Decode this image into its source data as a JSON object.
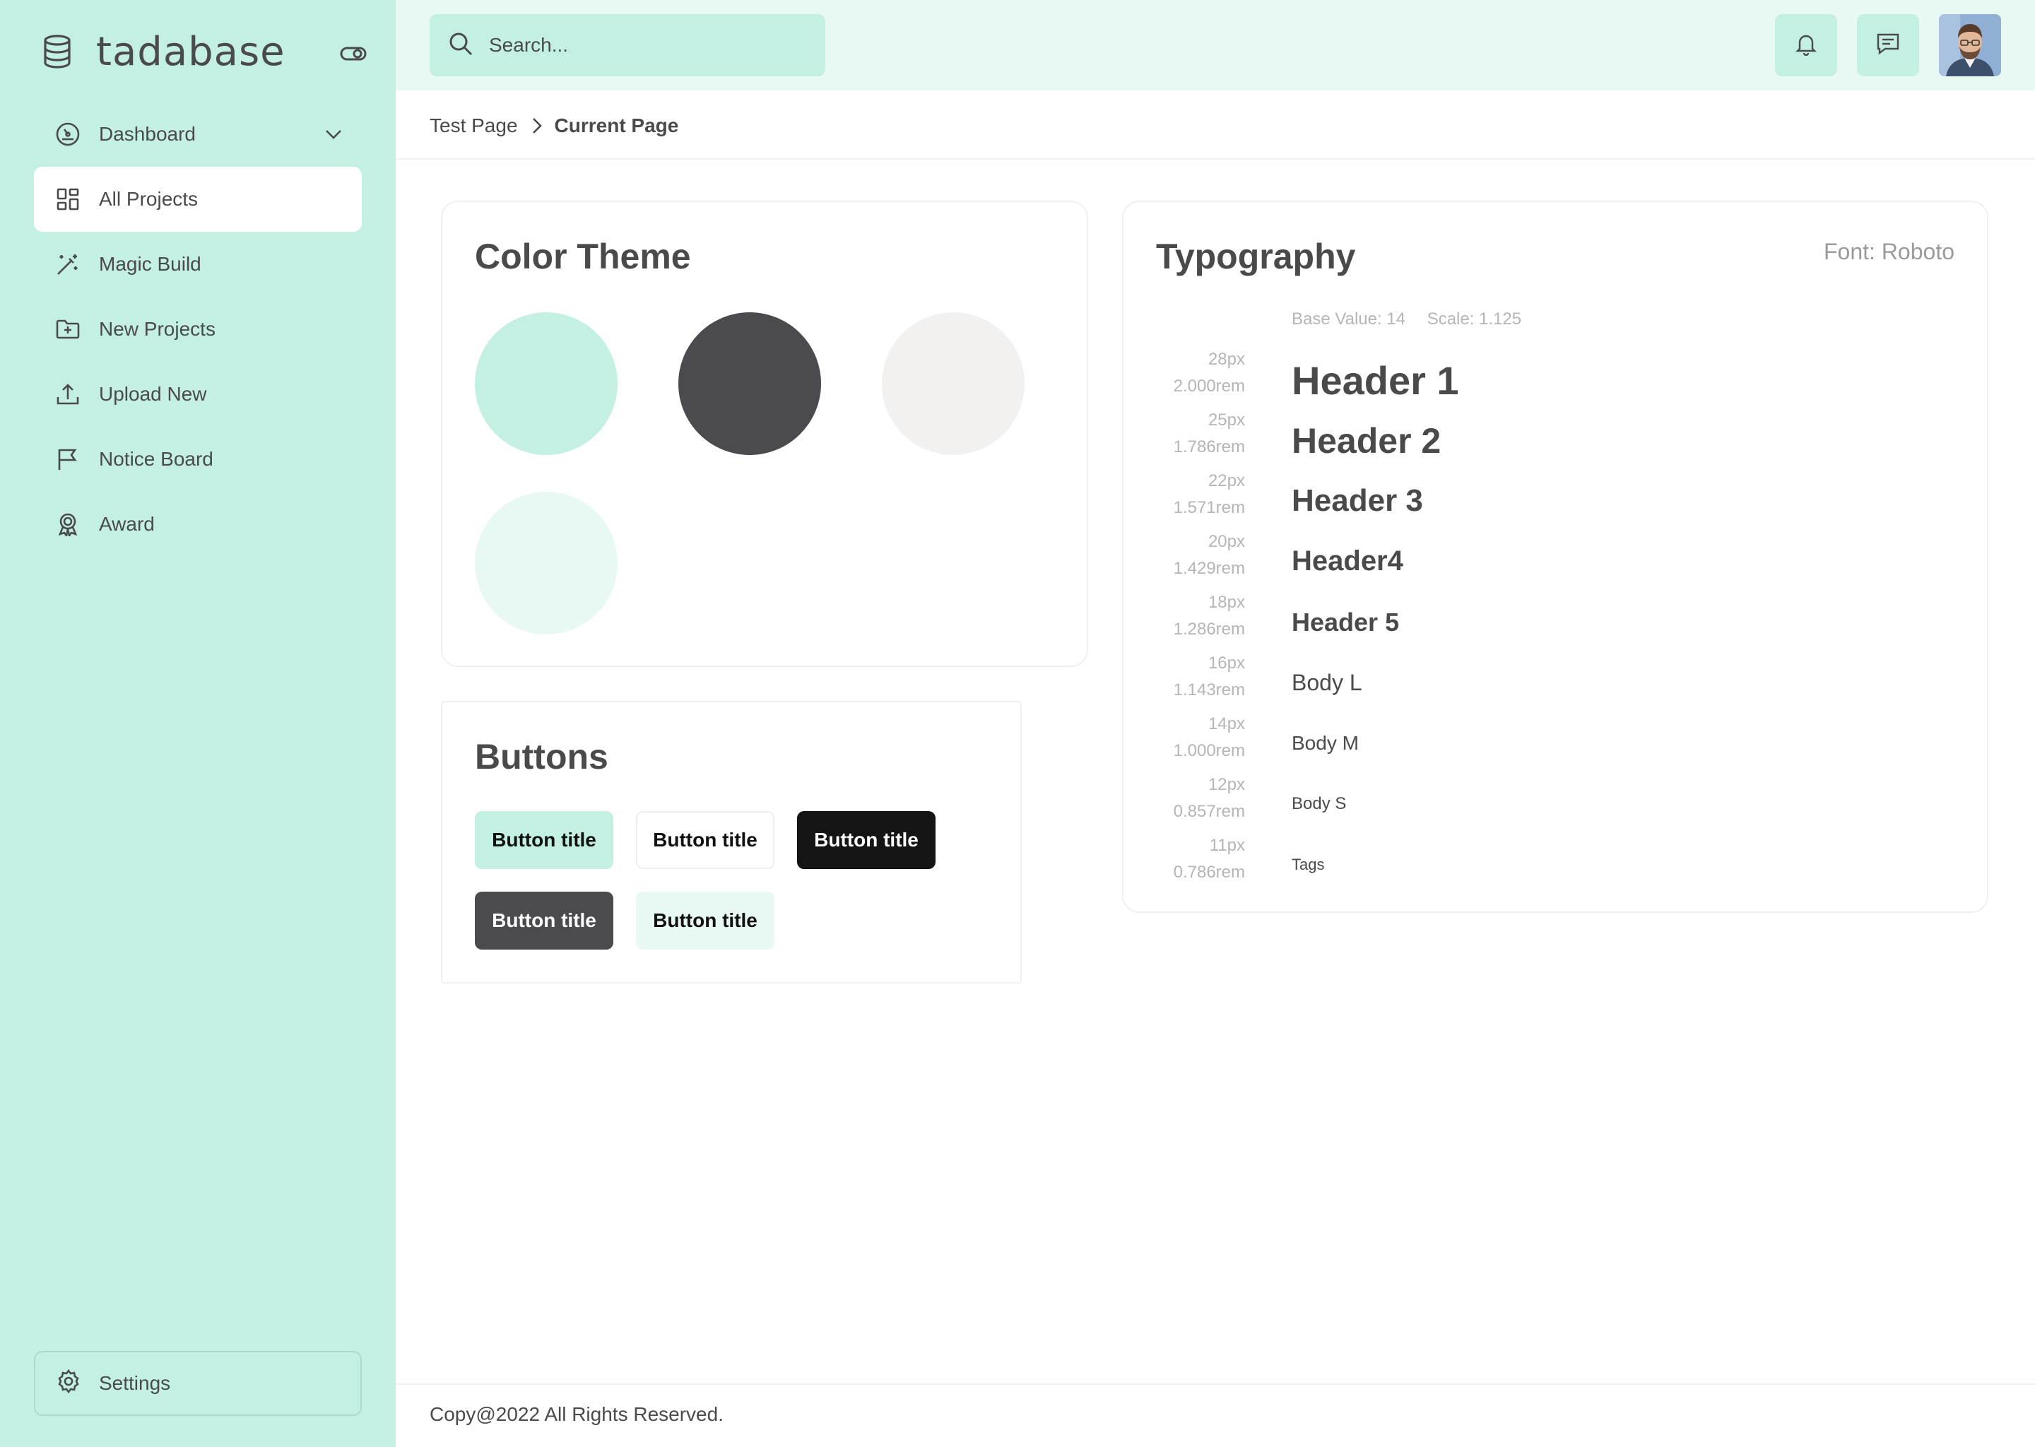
{
  "app": {
    "name": "tadabase"
  },
  "sidebar": {
    "items": [
      {
        "label": "Dashboard",
        "icon": "dashboard-gauge-icon",
        "has_chevron": true
      },
      {
        "label": "All Projects",
        "icon": "grid-icon",
        "active": true
      },
      {
        "label": "Magic Build",
        "icon": "magic-wand-icon"
      },
      {
        "label": "New Projects",
        "icon": "folder-plus-icon"
      },
      {
        "label": "Upload New",
        "icon": "upload-icon"
      },
      {
        "label": "Notice Board",
        "icon": "flag-icon"
      },
      {
        "label": "Award",
        "icon": "award-icon"
      }
    ],
    "settings_label": "Settings"
  },
  "topbar": {
    "search_placeholder": "Search...",
    "notification_icon": "bell-icon",
    "messages_icon": "chat-icon"
  },
  "breadcrumb": {
    "parent": "Test Page",
    "current": "Current Page"
  },
  "color_theme": {
    "title": "Color Theme",
    "swatches": [
      "#c4f0e3",
      "#4b4b4f",
      "#f2f1f0",
      "#e8f8f3"
    ]
  },
  "buttons_card": {
    "title": "Buttons",
    "buttons": [
      {
        "label": "Button title",
        "bg": "#c4f0e3",
        "color": "#111111"
      },
      {
        "label": "Button title",
        "bg": "#ffffff",
        "color": "#111111",
        "border": "#eeeeee"
      },
      {
        "label": "Button title",
        "bg": "#141414",
        "color": "#ffffff"
      },
      {
        "label": "Button title",
        "bg": "#4b4b4f",
        "color": "#ffffff"
      },
      {
        "label": "Button title",
        "bg": "#e8f8f3",
        "color": "#111111"
      }
    ]
  },
  "typography": {
    "title": "Typography",
    "font_label": "Font: Roboto",
    "base_value": "Base Value: 14",
    "scale": "Scale: 1.125",
    "rows": [
      {
        "px": "28px",
        "rem": "2.000rem",
        "label": "Header 1"
      },
      {
        "px": "25px",
        "rem": "1.786rem",
        "label": "Header 2"
      },
      {
        "px": "22px",
        "rem": "1.571rem",
        "label": "Header 3"
      },
      {
        "px": "20px",
        "rem": "1.429rem",
        "label": "Header4"
      },
      {
        "px": "18px",
        "rem": "1.286rem",
        "label": "Header 5"
      },
      {
        "px": "16px",
        "rem": "1.143rem",
        "label": "Body L"
      },
      {
        "px": "14px",
        "rem": "1.000rem",
        "label": "Body M"
      },
      {
        "px": "12px",
        "rem": "0.857rem",
        "label": "Body S"
      },
      {
        "px": "11px",
        "rem": "0.786rem",
        "label": "Tags"
      }
    ]
  },
  "footer": {
    "text": "Copy@2022 All Rights Reserved."
  }
}
